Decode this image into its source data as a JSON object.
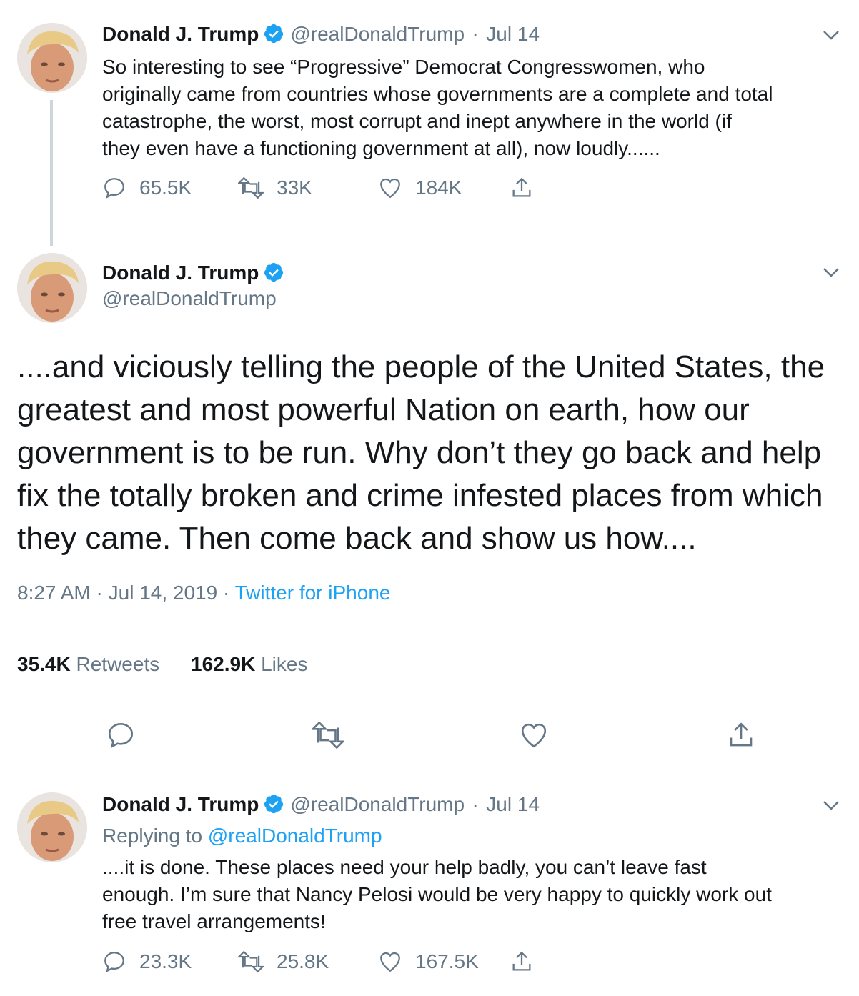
{
  "tweet1": {
    "name": "Donald J. Trump",
    "handle": "@realDonaldTrump",
    "sep": "·",
    "date": "Jul 14",
    "lines": [
      "So interesting to see “Progressive” Democrat Congresswomen, who",
      "originally came from countries whose governments are a complete and total",
      "catastrophe, the worst, most corrupt and inept anywhere in the world (if",
      "they even have a functioning government at all), now loudly......"
    ],
    "replies": "65.5K",
    "retweets": "33K",
    "likes": "184K"
  },
  "tweet2": {
    "name": "Donald J. Trump",
    "handle": "@realDonaldTrump",
    "lines": [
      "....and viciously telling the people of the United States, the",
      "greatest and most powerful Nation on earth, how our",
      "government is to be run. Why don’t they go back and help",
      "fix the totally broken and crime infested places from which",
      "they came. Then come back and show us how...."
    ],
    "time": "8:27 AM",
    "sep": "·",
    "date": "Jul 14, 2019",
    "source": "Twitter for iPhone",
    "retweet_count": "35.4K",
    "retweet_label": "Retweets",
    "like_count": "162.9K",
    "like_label": "Likes"
  },
  "tweet3": {
    "name": "Donald J. Trump",
    "handle": "@realDonaldTrump",
    "sep": "·",
    "date": "Jul 14",
    "replying_label": "Replying to",
    "replying_handle": "@realDonaldTrump",
    "lines": [
      "....it is done. These places need your help badly, you can’t leave fast",
      "enough. I’m sure that Nancy Pelosi would be very happy to quickly work out",
      "free travel arrangements!"
    ],
    "replies": "23.3K",
    "retweets": "25.8K",
    "likes": "167.5K"
  },
  "colors": {
    "accent": "#1da1f2",
    "muted": "#657786",
    "text": "#14171a",
    "border": "#e6ecf0",
    "thread": "#ccd6dd"
  }
}
